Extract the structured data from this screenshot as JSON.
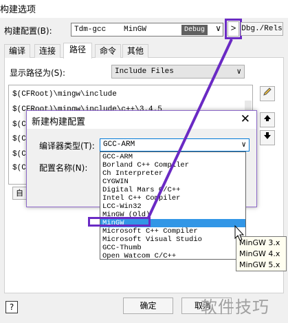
{
  "window": {
    "title": "构建选项"
  },
  "build_config": {
    "label": "构建配置(B):",
    "name": "Tdm-gcc",
    "compiler": "MinGW",
    "badge": "Debug",
    "arrow": "∨",
    "nav_button": ">",
    "output_button": "Dbg./Rels"
  },
  "tabs": [
    {
      "label": "编译"
    },
    {
      "label": "连接"
    },
    {
      "label": "路径",
      "active": true
    },
    {
      "label": "命令"
    },
    {
      "label": "其他"
    }
  ],
  "paths": {
    "label": "显示路径为(S):",
    "selected": "Include Files",
    "items": [
      "$(CFRoot)\\mingw\\include",
      "$(CFRoot)\\mingw\\include\\c++\\3.4.5",
      "$(CFRoot)",
      "$(CF",
      "$(CF",
      "$(CF"
    ]
  },
  "auto_button": "自",
  "dialog": {
    "title": "新建构建配置",
    "close": "✕",
    "compiler_type_label": "编译器类型(T):",
    "compiler_type_value": "GCC-ARM",
    "config_name_label": "配置名称(N):",
    "compiler_options": [
      "GCC-ARM",
      "Borland C++ Compiler",
      "Ch Interpreter",
      "CYGWIN",
      "Digital Mars C/C++",
      "Intel C++ Compiler",
      "LCC-Win32",
      "MinGW (Old)",
      "MinGW",
      "Microsoft C++ Compiler",
      "Microsoft Visual Studio",
      "GCC-Thumb",
      "Open Watcom C/C++"
    ],
    "selected_option": "MinGW"
  },
  "tooltip": {
    "lines": [
      "MinGW 3.x",
      "MinGW 4.x",
      "MinGW 5.x"
    ]
  },
  "buttons": {
    "help": "?",
    "ok": "确定",
    "cancel": "取消"
  },
  "watermark": "软件技巧",
  "colors": {
    "annotation": "#6a2ac4",
    "selection": "#3296e6"
  },
  "icons": {
    "edit": "pencil-icon",
    "up": "arrow-up-icon",
    "down": "arrow-down-icon"
  }
}
